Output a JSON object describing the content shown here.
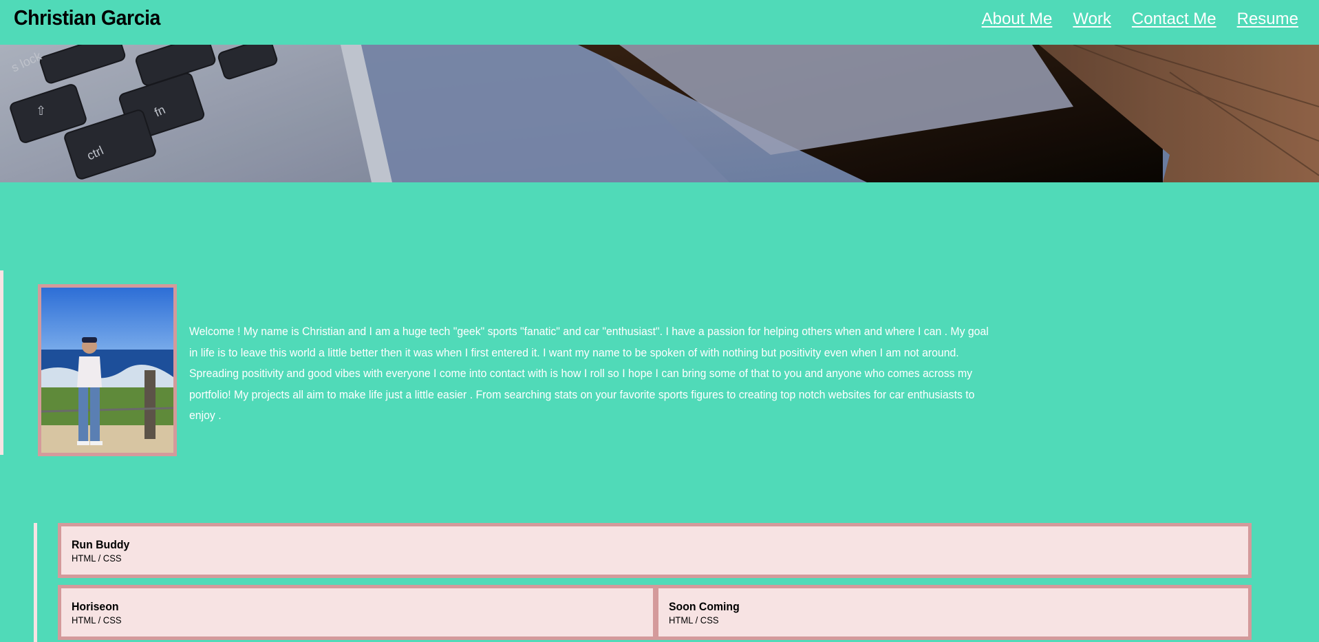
{
  "header": {
    "title": "Christian Garcia",
    "nav": [
      "About Me",
      "Work",
      "Contact Me",
      "Resume"
    ]
  },
  "about": {
    "bio": "Welcome ! My name is Christian and I am a huge tech \"geek\" sports \"fanatic\" and car \"enthusiast\". I have a passion for helping others when and where I can . My goal in life is to leave this world a little better then it was when I first entered it. I want my name to be spoken of with nothing but positivity even when I am not around. Spreading positivity and good vibes with everyone I come into contact with is how I roll so I hope I can bring some of that to you and anyone who comes across my portfolio! My projects all aim to make life just a little easier . From searching stats on your favorite sports figures to creating top notch websites for car enthusiasts to enjoy ."
  },
  "work": {
    "projects": [
      {
        "title": "Run Buddy",
        "tech": "HTML / CSS"
      },
      {
        "title": "Horiseon",
        "tech": "HTML / CSS"
      },
      {
        "title": "Soon Coming",
        "tech": "HTML / CSS"
      }
    ]
  },
  "colors": {
    "background": "#50dab8",
    "card": "#f7e3e3",
    "card_border": "#d49a9b",
    "nav_text": "#ffffff"
  },
  "icons": {
    "hero": "laptop-keyboard-and-phone-photo",
    "profile": "profile-photo-at-beach"
  }
}
